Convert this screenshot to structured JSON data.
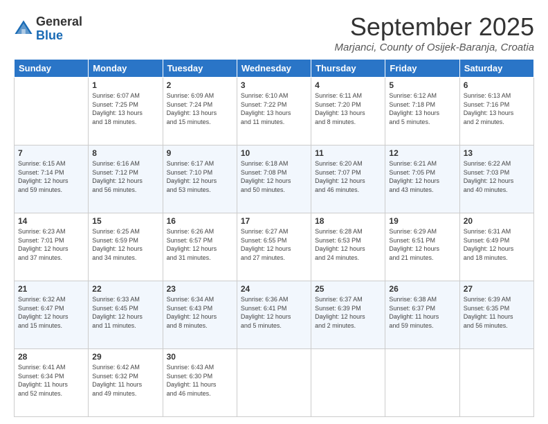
{
  "header": {
    "logo_general": "General",
    "logo_blue": "Blue",
    "month": "September 2025",
    "location": "Marjanci, County of Osijek-Baranja, Croatia"
  },
  "days_of_week": [
    "Sunday",
    "Monday",
    "Tuesday",
    "Wednesday",
    "Thursday",
    "Friday",
    "Saturday"
  ],
  "weeks": [
    [
      {
        "day": null,
        "info": null
      },
      {
        "day": "1",
        "info": "Sunrise: 6:07 AM\nSunset: 7:25 PM\nDaylight: 13 hours\nand 18 minutes."
      },
      {
        "day": "2",
        "info": "Sunrise: 6:09 AM\nSunset: 7:24 PM\nDaylight: 13 hours\nand 15 minutes."
      },
      {
        "day": "3",
        "info": "Sunrise: 6:10 AM\nSunset: 7:22 PM\nDaylight: 13 hours\nand 11 minutes."
      },
      {
        "day": "4",
        "info": "Sunrise: 6:11 AM\nSunset: 7:20 PM\nDaylight: 13 hours\nand 8 minutes."
      },
      {
        "day": "5",
        "info": "Sunrise: 6:12 AM\nSunset: 7:18 PM\nDaylight: 13 hours\nand 5 minutes."
      },
      {
        "day": "6",
        "info": "Sunrise: 6:13 AM\nSunset: 7:16 PM\nDaylight: 13 hours\nand 2 minutes."
      }
    ],
    [
      {
        "day": "7",
        "info": "Sunrise: 6:15 AM\nSunset: 7:14 PM\nDaylight: 12 hours\nand 59 minutes."
      },
      {
        "day": "8",
        "info": "Sunrise: 6:16 AM\nSunset: 7:12 PM\nDaylight: 12 hours\nand 56 minutes."
      },
      {
        "day": "9",
        "info": "Sunrise: 6:17 AM\nSunset: 7:10 PM\nDaylight: 12 hours\nand 53 minutes."
      },
      {
        "day": "10",
        "info": "Sunrise: 6:18 AM\nSunset: 7:08 PM\nDaylight: 12 hours\nand 50 minutes."
      },
      {
        "day": "11",
        "info": "Sunrise: 6:20 AM\nSunset: 7:07 PM\nDaylight: 12 hours\nand 46 minutes."
      },
      {
        "day": "12",
        "info": "Sunrise: 6:21 AM\nSunset: 7:05 PM\nDaylight: 12 hours\nand 43 minutes."
      },
      {
        "day": "13",
        "info": "Sunrise: 6:22 AM\nSunset: 7:03 PM\nDaylight: 12 hours\nand 40 minutes."
      }
    ],
    [
      {
        "day": "14",
        "info": "Sunrise: 6:23 AM\nSunset: 7:01 PM\nDaylight: 12 hours\nand 37 minutes."
      },
      {
        "day": "15",
        "info": "Sunrise: 6:25 AM\nSunset: 6:59 PM\nDaylight: 12 hours\nand 34 minutes."
      },
      {
        "day": "16",
        "info": "Sunrise: 6:26 AM\nSunset: 6:57 PM\nDaylight: 12 hours\nand 31 minutes."
      },
      {
        "day": "17",
        "info": "Sunrise: 6:27 AM\nSunset: 6:55 PM\nDaylight: 12 hours\nand 27 minutes."
      },
      {
        "day": "18",
        "info": "Sunrise: 6:28 AM\nSunset: 6:53 PM\nDaylight: 12 hours\nand 24 minutes."
      },
      {
        "day": "19",
        "info": "Sunrise: 6:29 AM\nSunset: 6:51 PM\nDaylight: 12 hours\nand 21 minutes."
      },
      {
        "day": "20",
        "info": "Sunrise: 6:31 AM\nSunset: 6:49 PM\nDaylight: 12 hours\nand 18 minutes."
      }
    ],
    [
      {
        "day": "21",
        "info": "Sunrise: 6:32 AM\nSunset: 6:47 PM\nDaylight: 12 hours\nand 15 minutes."
      },
      {
        "day": "22",
        "info": "Sunrise: 6:33 AM\nSunset: 6:45 PM\nDaylight: 12 hours\nand 11 minutes."
      },
      {
        "day": "23",
        "info": "Sunrise: 6:34 AM\nSunset: 6:43 PM\nDaylight: 12 hours\nand 8 minutes."
      },
      {
        "day": "24",
        "info": "Sunrise: 6:36 AM\nSunset: 6:41 PM\nDaylight: 12 hours\nand 5 minutes."
      },
      {
        "day": "25",
        "info": "Sunrise: 6:37 AM\nSunset: 6:39 PM\nDaylight: 12 hours\nand 2 minutes."
      },
      {
        "day": "26",
        "info": "Sunrise: 6:38 AM\nSunset: 6:37 PM\nDaylight: 11 hours\nand 59 minutes."
      },
      {
        "day": "27",
        "info": "Sunrise: 6:39 AM\nSunset: 6:35 PM\nDaylight: 11 hours\nand 56 minutes."
      }
    ],
    [
      {
        "day": "28",
        "info": "Sunrise: 6:41 AM\nSunset: 6:34 PM\nDaylight: 11 hours\nand 52 minutes."
      },
      {
        "day": "29",
        "info": "Sunrise: 6:42 AM\nSunset: 6:32 PM\nDaylight: 11 hours\nand 49 minutes."
      },
      {
        "day": "30",
        "info": "Sunrise: 6:43 AM\nSunset: 6:30 PM\nDaylight: 11 hours\nand 46 minutes."
      },
      {
        "day": null,
        "info": null
      },
      {
        "day": null,
        "info": null
      },
      {
        "day": null,
        "info": null
      },
      {
        "day": null,
        "info": null
      }
    ]
  ]
}
